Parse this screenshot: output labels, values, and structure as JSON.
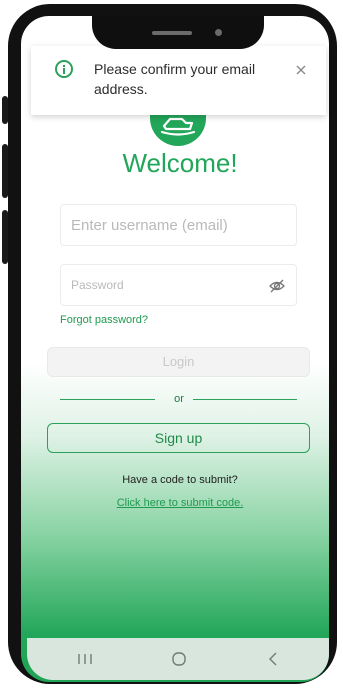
{
  "toast": {
    "message": "Please confirm your email address.",
    "icon": "info-icon",
    "close_icon": "close-icon"
  },
  "welcome": "Welcome!",
  "username": {
    "placeholder": "Enter username (email)",
    "value": ""
  },
  "password": {
    "placeholder": "Password",
    "value": "",
    "toggle_icon": "eye-off-icon"
  },
  "forgot_password": "Forgot password?",
  "login_button": "Login",
  "divider_text": "or",
  "signup_button": "Sign up",
  "code_prompt": "Have a code to submit?",
  "code_link": "Click here to submit code.",
  "nav": {
    "recent_icon": "recent-apps-icon",
    "home_icon": "home-icon",
    "back_icon": "back-icon"
  },
  "colors": {
    "brand_green": "#22a659",
    "link_green": "#1f9a4f",
    "nav_bar": "#d8e6dd"
  }
}
